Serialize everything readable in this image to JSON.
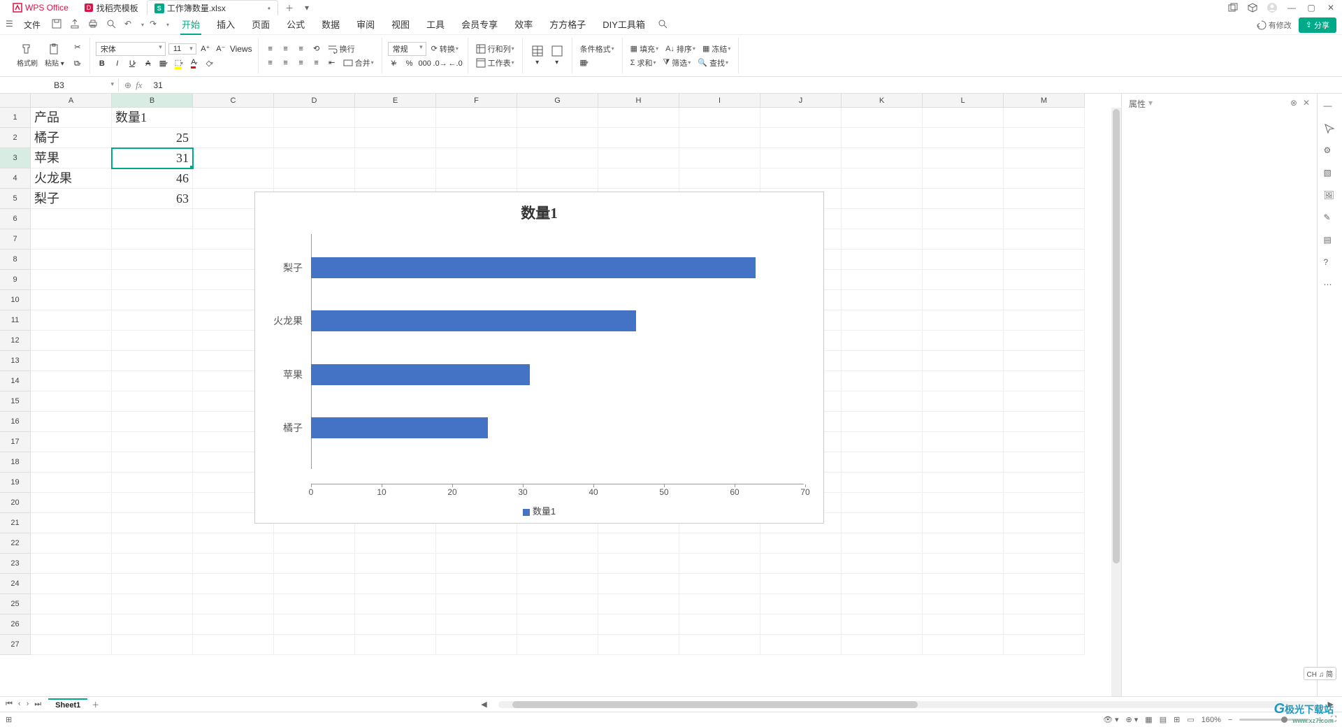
{
  "titlebar": {
    "app_tab": "WPS Office",
    "template_tab": "找稻壳模板",
    "file_tab": "工作簿数量.xlsx",
    "file_tab_badge": "S"
  },
  "menubar": {
    "file": "文件",
    "tabs": [
      "开始",
      "插入",
      "页面",
      "公式",
      "数据",
      "审阅",
      "视图",
      "工具",
      "会员专享",
      "效率",
      "方方格子",
      "DIY工具箱"
    ],
    "active_tab_index": 0,
    "modify": "有修改",
    "share": "分享"
  },
  "toolbar": {
    "format_brush": "格式刷",
    "paste": "粘贴",
    "font_name": "宋体",
    "font_size": "11",
    "wrap": "换行",
    "number_format": "常规",
    "convert": "转换",
    "row_col": "行和列",
    "worksheet": "工作表",
    "cond_format": "条件格式",
    "fill": "填充",
    "sort": "排序",
    "freeze": "冻结",
    "sum": "求和",
    "filter": "筛选",
    "find": "查找",
    "merge": "合并"
  },
  "namebox": "B3",
  "formula": "31",
  "columns": [
    "A",
    "B",
    "C",
    "D",
    "E",
    "F",
    "G",
    "H",
    "I",
    "J",
    "K",
    "L",
    "M"
  ],
  "rows_count": 27,
  "selected_cell": {
    "row": 3,
    "col": 1
  },
  "data": {
    "A1": "产品",
    "B1": "数量1",
    "A2": "橘子",
    "B2": "25",
    "A3": "苹果",
    "B3": "31",
    "A4": "火龙果",
    "B4": "46",
    "A5": "梨子",
    "B5": "63"
  },
  "chart_data": {
    "type": "bar",
    "title": "数量1",
    "categories": [
      "梨子",
      "火龙果",
      "苹果",
      "橘子"
    ],
    "values": [
      63,
      46,
      31,
      25
    ],
    "series_name": "数量1",
    "xlim": [
      0,
      70
    ],
    "xticks": [
      0,
      10,
      20,
      30,
      40,
      50,
      60,
      70
    ]
  },
  "sheettabs": {
    "active": "Sheet1"
  },
  "statusbar": {
    "zoom": "160%"
  },
  "props_panel": {
    "title": "属性"
  },
  "ime": "CH ♫ 简",
  "watermark": {
    "main": "极光下载站",
    "sub": "www.xz7.com"
  }
}
